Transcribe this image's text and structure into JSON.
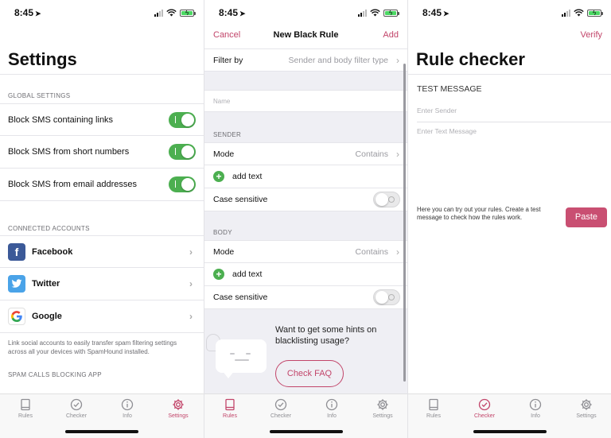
{
  "status_bar": {
    "time": "8:45"
  },
  "settings_screen": {
    "title": "Settings",
    "global_section": "GLOBAL SETTINGS",
    "toggles": [
      {
        "label": "Block SMS containing links",
        "on": true
      },
      {
        "label": "Block SMS from short numbers",
        "on": true
      },
      {
        "label": "Block SMS from email addresses",
        "on": true
      }
    ],
    "accounts_section": "CONNECTED ACCOUNTS",
    "accounts": [
      {
        "label": "Facebook",
        "icon": "facebook-icon"
      },
      {
        "label": "Twitter",
        "icon": "twitter-icon"
      },
      {
        "label": "Google",
        "icon": "google-icon"
      }
    ],
    "accounts_note": "Link social accounts to easily transfer spam filtering settings across all your devices with SpamHound installed.",
    "calls_section": "SPAM CALLS BLOCKING APP"
  },
  "rule_screen": {
    "nav": {
      "cancel": "Cancel",
      "title": "New Black Rule",
      "add": "Add"
    },
    "filter_by": {
      "label": "Filter by",
      "value": "Sender and body filter type"
    },
    "name_placeholder": "Name",
    "sender": {
      "section": "SENDER",
      "mode_label": "Mode",
      "mode_value": "Contains",
      "add_text": "add text",
      "case_label": "Case sensitive",
      "case_on": false
    },
    "body": {
      "section": "BODY",
      "mode_label": "Mode",
      "mode_value": "Contains",
      "add_text": "add text",
      "case_label": "Case sensitive",
      "case_on": false
    },
    "hint": "Want to get some hints on blacklisting usage?",
    "faq_button": "Check FAQ"
  },
  "checker_screen": {
    "verify": "Verify",
    "title": "Rule checker",
    "test_label": "TEST MESSAGE",
    "sender_placeholder": "Enter Sender",
    "text_placeholder": "Enter Text Message",
    "help": "Here you can try out your rules. Create a test message to check how the rules work.",
    "paste_button": "Paste"
  },
  "tabs": [
    "Rules",
    "Checker",
    "Info",
    "Settings"
  ],
  "active_tabs": {
    "settings_screen": "Settings",
    "rule_screen": "Rules",
    "checker_screen": "Checker"
  },
  "colors": {
    "accent": "#c2456a",
    "toggle_on": "#4caf50",
    "paste": "#c94f72"
  }
}
